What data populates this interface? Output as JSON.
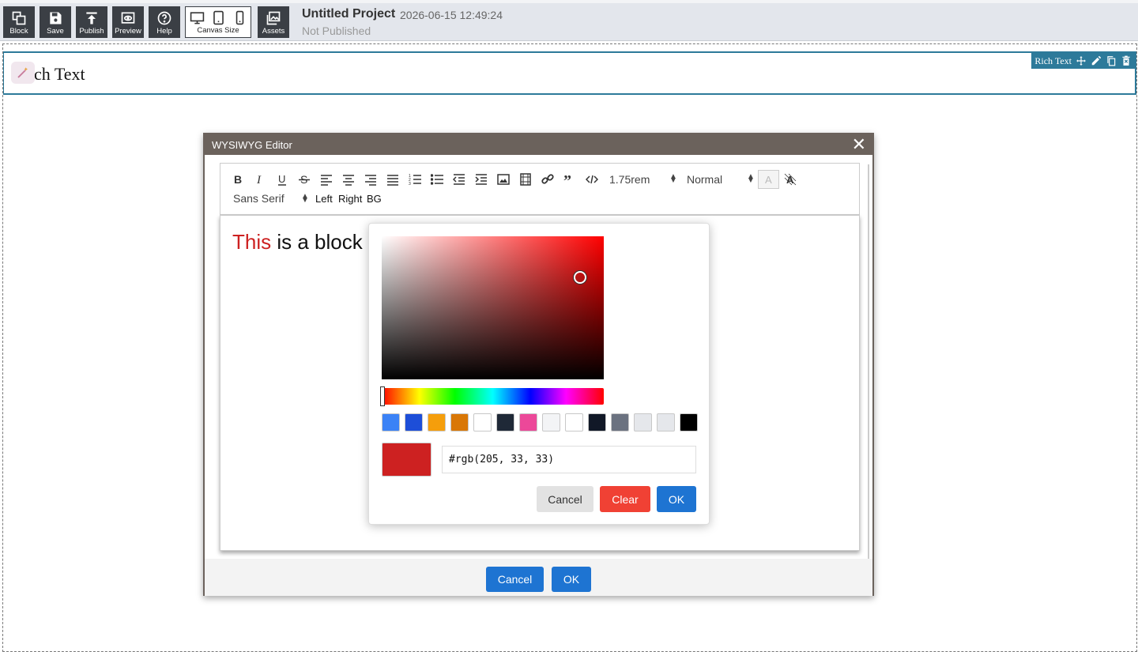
{
  "toolbar": {
    "buttons": [
      {
        "label": "Block",
        "icon": "block-icon"
      },
      {
        "label": "Save",
        "icon": "save-icon"
      },
      {
        "label": "Publish",
        "icon": "publish-icon"
      },
      {
        "label": "Preview",
        "icon": "preview-icon"
      },
      {
        "label": "Help",
        "icon": "help-icon"
      },
      {
        "label": "Canvas Size",
        "icon": "canvas-size-icon"
      },
      {
        "label": "Assets",
        "icon": "assets-icon"
      }
    ]
  },
  "project": {
    "title": "Untitled Project",
    "datetime": "2026-06-15 12:49:24",
    "status": "Not Published"
  },
  "block": {
    "text": "ch Text",
    "tools_label": "Rich Text"
  },
  "modal": {
    "title": "WYSIWYG Editor",
    "close": "✕",
    "font_size": "1.75rem",
    "paragraph_style": "Normal",
    "font_family": "Sans Serif",
    "left_label": "Left",
    "right_label": "Right",
    "bg_label": "BG",
    "content_red": "This",
    "content_rest": " is a block",
    "cancel_label": "Cancel",
    "ok_label": "OK"
  },
  "color_picker": {
    "hue_color": "#ff0000",
    "swatches": [
      "#3b82f6",
      "#1d4ed8",
      "#f59e0b",
      "#d97706",
      "#ffffff",
      "#1f2937",
      "#ec4899",
      "#f3f4f6",
      "#ffffff",
      "#111827",
      "#6b7280",
      "#e5e7eb",
      "#e5e7eb",
      "#000000"
    ],
    "current_color": "#cd2121",
    "value": "#rgb(205, 33, 33)",
    "cancel_label": "Cancel",
    "clear_label": "Clear",
    "ok_label": "OK"
  },
  "colors": {
    "toolbar_button_bg": "#3b3f45",
    "accent": "#1e74d2",
    "clear": "#f04134",
    "modal_header": "#6b625c",
    "block_border": "#2d7a9a"
  }
}
